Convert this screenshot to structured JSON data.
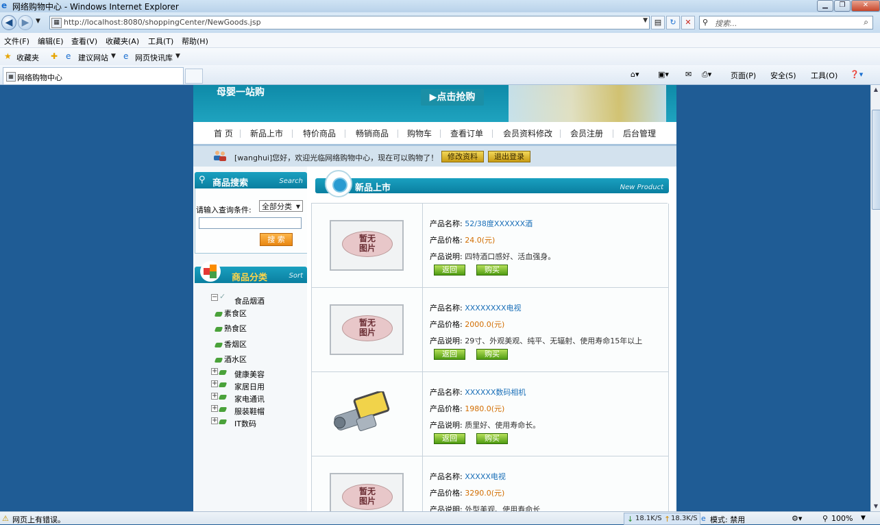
{
  "window": {
    "title": "网络购物中心 - Windows Internet Explorer"
  },
  "address": {
    "url": "http://localhost:8080/shoppingCenter/NewGoods.jsp",
    "search_placeholder": "搜索..."
  },
  "menu": [
    "文件(F)",
    "编辑(E)",
    "查看(V)",
    "收藏夹(A)",
    "工具(T)",
    "帮助(H)"
  ],
  "favbar": {
    "favorites": "收藏夹",
    "suggested": "建议网站",
    "slices": "网页快讯库"
  },
  "tab": {
    "title": "网络购物中心"
  },
  "tools": {
    "page": "页面(P)",
    "safety": "安全(S)",
    "tools": "工具(O)"
  },
  "banner": {
    "slogan": "母婴一站购",
    "buy": "▶点击抢购"
  },
  "nav": [
    "首 页",
    "新品上市",
    "特价商品",
    "畅销商品",
    "购物车",
    "查看订单",
    "会员资料修改",
    "会员注册",
    "后台管理"
  ],
  "welcome": {
    "text": "[wanghui]您好，欢迎光临网络购物中心，现在可以购物了！",
    "edit": "修改资料",
    "logout": "退出登录"
  },
  "search": {
    "title": "商品搜索",
    "title_en": "Search",
    "label": "请输入查询条件:",
    "select": "全部分类",
    "button": "搜 索"
  },
  "sort": {
    "title": "商品分类",
    "title_en": "Sort",
    "root": "食品烟酒",
    "children": [
      "素食区",
      "熟食区",
      "香烟区",
      "酒水区"
    ],
    "others": [
      "健康美容",
      "家居日用",
      "家电通讯",
      "服装鞋帽",
      "IT数码"
    ]
  },
  "main": {
    "title": "新品上市",
    "title_en": "New Product"
  },
  "labels": {
    "name": "产品名称:",
    "price": "产品价格:",
    "desc": "产品说明:",
    "back": "返回",
    "buy": "购买"
  },
  "noimage": [
    "暂无",
    "图片"
  ],
  "products": [
    {
      "name": "52/38度XXXXXX酒",
      "price": "24.0(元)",
      "desc": "四特酒口感好、活血强身。",
      "image": "none"
    },
    {
      "name": "XXXXXXXX电视",
      "price": "2000.0(元)",
      "desc": "29寸、外观美观、纯平、无辐射、使用寿命15年以上",
      "image": "none"
    },
    {
      "name": "XXXXXX数码相机",
      "price": "1980.0(元)",
      "desc": "质里好、使用寿命长。",
      "image": "camera"
    },
    {
      "name": "XXXXX电视",
      "price": "3290.0(元)",
      "desc": "外型美观、使用寿命长",
      "image": "none"
    }
  ],
  "status": {
    "error": "网页上有错误。",
    "down": "18.1K/S",
    "up": "18.3K/S",
    "mode": "模式: 禁用",
    "zoom": "100%"
  }
}
